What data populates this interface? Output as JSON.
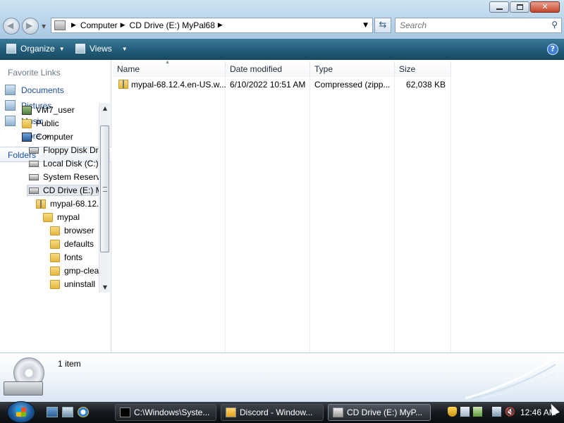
{
  "address": {
    "crumbs": [
      "Computer",
      "CD Drive (E:) MyPal68"
    ],
    "search_placeholder": "Search"
  },
  "toolbar": {
    "organize_label": "Organize",
    "views_label": "Views"
  },
  "favorite_links": {
    "header": "Favorite Links",
    "items": [
      {
        "label": "Documents"
      },
      {
        "label": "Pictures"
      },
      {
        "label": "Music"
      }
    ],
    "more_label": "More",
    "more_glyph": "»"
  },
  "folders": {
    "header": "Folders",
    "tree": [
      {
        "label": "VM7_user",
        "icon": "user-icon"
      },
      {
        "label": "Public",
        "icon": "folder-icon"
      },
      {
        "label": "Computer",
        "icon": "computer-icon"
      },
      {
        "label": "Floppy Disk Dr",
        "icon": "drive-icon"
      },
      {
        "label": "Local Disk (C:)",
        "icon": "drive-icon"
      },
      {
        "label": "System Reserve",
        "icon": "drive-icon"
      },
      {
        "label": "CD Drive (E:) M",
        "icon": "cd-drive-icon"
      },
      {
        "label": "mypal-68.12.",
        "icon": "zip-folder-icon"
      },
      {
        "label": "mypal",
        "icon": "folder-icon"
      },
      {
        "label": "browser",
        "icon": "folder-icon"
      },
      {
        "label": "defaults",
        "icon": "folder-icon"
      },
      {
        "label": "fonts",
        "icon": "folder-icon"
      },
      {
        "label": "gmp-clea",
        "icon": "folder-icon"
      },
      {
        "label": "uninstall",
        "icon": "folder-icon"
      }
    ]
  },
  "file_list": {
    "columns": [
      "Name",
      "Date modified",
      "Type",
      "Size"
    ],
    "rows": [
      {
        "name": "mypal-68.12.4.en-US.w...",
        "date": "6/10/2022 10:51 AM",
        "type": "Compressed (zipp...",
        "size": "62,038 KB"
      }
    ]
  },
  "details": {
    "count": "1 item"
  },
  "taskbar": {
    "tasks": [
      {
        "label": "C:\\Windows\\Syste..."
      },
      {
        "label": "Discord - Window..."
      },
      {
        "label": "CD Drive (E:) MyP..."
      }
    ],
    "clock": "12:46 AM"
  },
  "colors": {
    "toolbar": "#245f7d",
    "link": "#1b4fa0",
    "taskbar": "#15181c"
  }
}
